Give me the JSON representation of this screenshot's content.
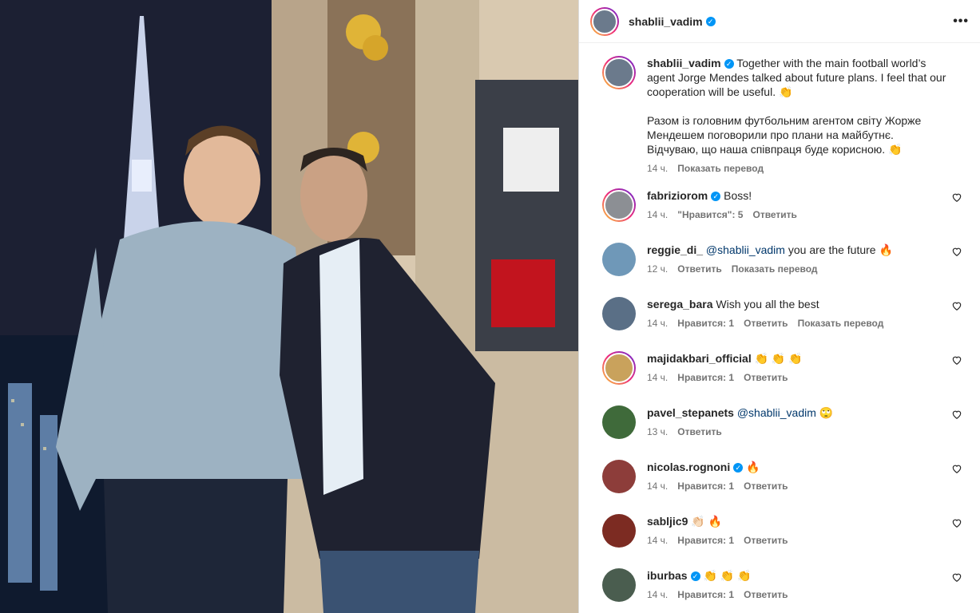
{
  "post": {
    "author": "shablii_vadim",
    "more_label": "•••",
    "caption_en": "Together with the main football world’s agent Jorge Mendes talked about future plans. I feel that our cooperation will be useful. 👏",
    "caption_uk": "Разом із головним футбольним агентом світу Жорже Мендешем поговорили про плани на майбутнє. Відчуваю, що наша співпраця буде корисною. 👏",
    "caption_time": "14 ч.",
    "caption_translate": "Показать перевод"
  },
  "comments": [
    {
      "user": "fabriziorom",
      "verified": true,
      "text": "Boss!",
      "time": "14 ч.",
      "likes": "\"Нравится\": 5",
      "reply": "Ответить",
      "translate": ""
    },
    {
      "user": "reggie_di_",
      "verified": false,
      "mention": "@shablii_vadim",
      "text": "you are the future 🔥",
      "time": "12 ч.",
      "likes": "",
      "reply": "Ответить",
      "translate": "Показать перевод"
    },
    {
      "user": "serega_bara",
      "verified": false,
      "text": "Wish you all the best",
      "time": "14 ч.",
      "likes": "Нравится: 1",
      "reply": "Ответить",
      "translate": "Показать перевод"
    },
    {
      "user": "majidakbari_official",
      "verified": false,
      "text": "👏 👏 👏",
      "time": "14 ч.",
      "likes": "Нравится: 1",
      "reply": "Ответить",
      "translate": ""
    },
    {
      "user": "pavel_stepanets",
      "verified": false,
      "mention": "@shablii_vadim",
      "text": "🙄",
      "time": "13 ч.",
      "likes": "",
      "reply": "Ответить",
      "translate": ""
    },
    {
      "user": "nicolas.rognoni",
      "verified": true,
      "text": "🔥",
      "time": "14 ч.",
      "likes": "Нравится: 1",
      "reply": "Ответить",
      "translate": ""
    },
    {
      "user": "sabljic9",
      "verified": false,
      "text": "👏🏻 🔥",
      "time": "14 ч.",
      "likes": "Нравится: 1",
      "reply": "Ответить",
      "translate": ""
    },
    {
      "user": "iburbas",
      "verified": true,
      "text": "👏 👏 👏",
      "time": "14 ч.",
      "likes": "Нравится: 1",
      "reply": "Ответить",
      "translate": ""
    }
  ],
  "icons": {
    "verified": "verified-badge-icon",
    "heart": "heart-icon",
    "more": "more-options-icon"
  },
  "colors": {
    "verified": "#0095f6",
    "mention": "#00376b",
    "meta": "#737373"
  }
}
